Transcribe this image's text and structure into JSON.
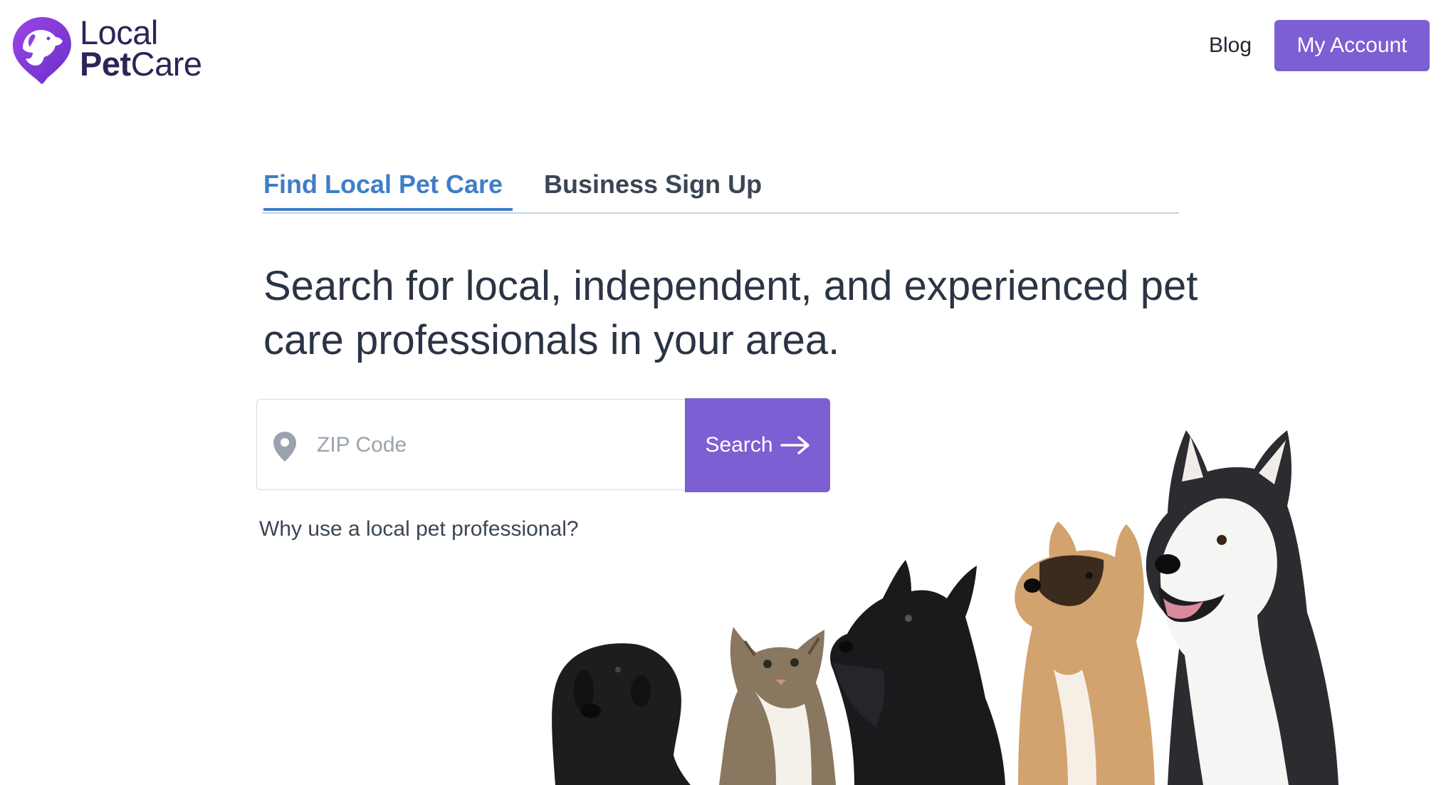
{
  "header": {
    "logo": {
      "line1": "Local",
      "line2_bold": "Pet",
      "line2_rest": "Care"
    },
    "nav": {
      "blog_label": "Blog",
      "account_label": "My Account"
    }
  },
  "tabs": [
    {
      "label": "Find Local Pet Care",
      "active": true
    },
    {
      "label": "Business Sign Up",
      "active": false
    }
  ],
  "main": {
    "headline": "Search for local, independent, and experienced pet care professionals in your area.",
    "search": {
      "placeholder": "ZIP Code",
      "value": "",
      "button_label": "Search"
    },
    "why_link": "Why use a local pet professional?"
  },
  "icons": {
    "logo": "dog-in-pin-logo-icon",
    "pin": "map-pin-icon",
    "arrow": "arrow-right-icon"
  },
  "colors": {
    "brand_purple": "#7b5fd3",
    "tab_active": "#3f7ec6",
    "text_dark": "#2b3445"
  }
}
